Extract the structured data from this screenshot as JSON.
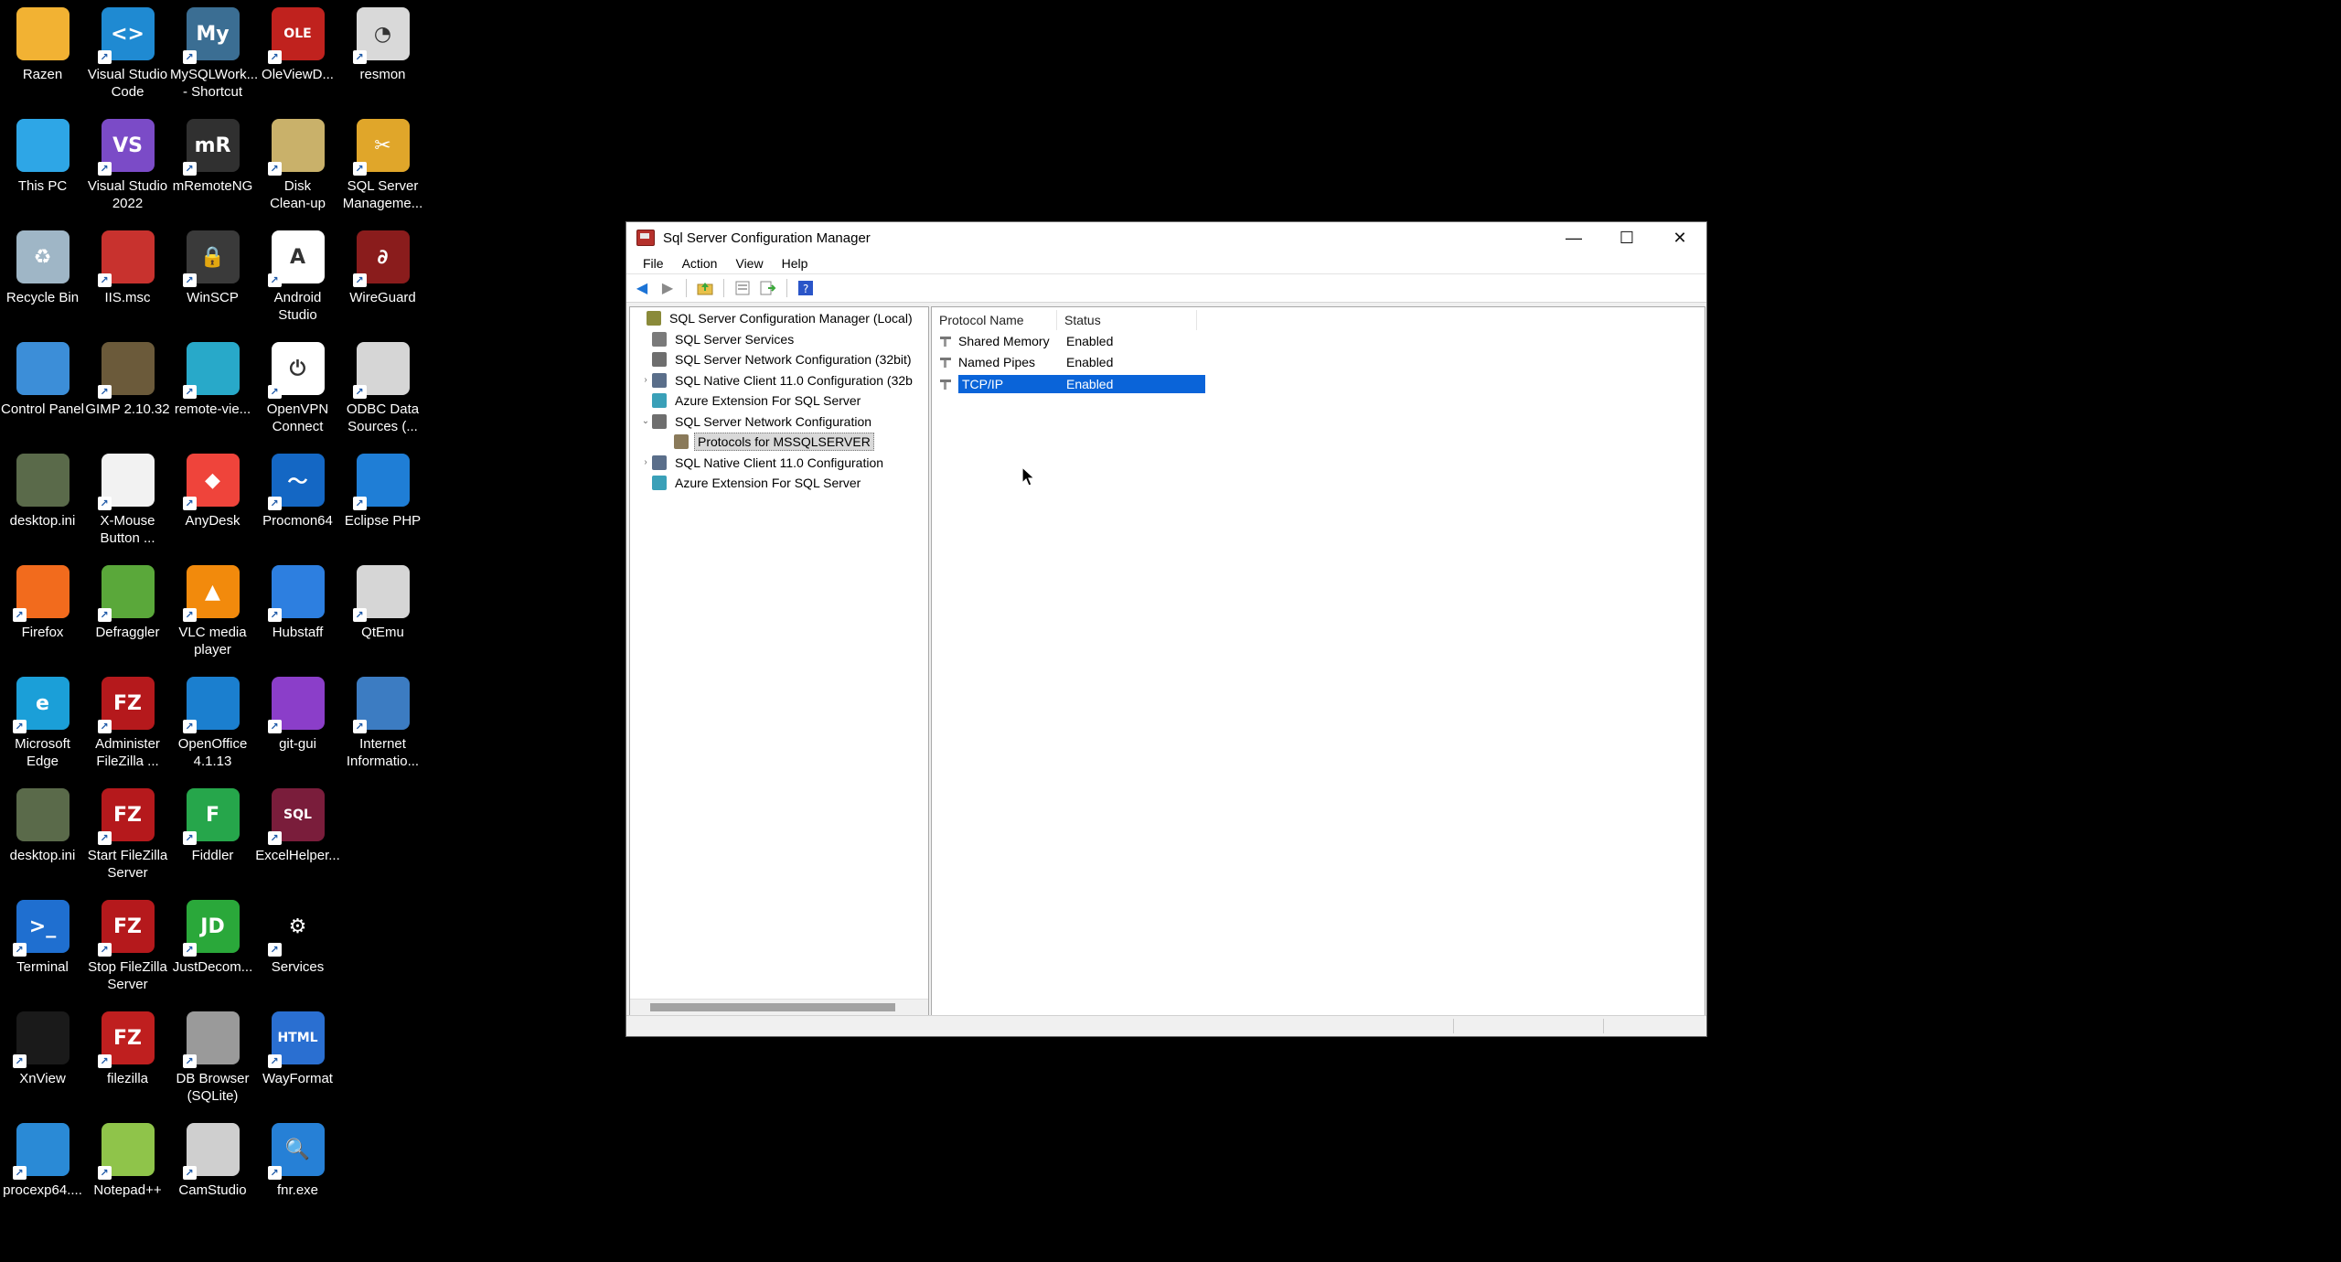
{
  "desktop": {
    "icons": [
      {
        "label": "Razen",
        "icon": "folder-icon",
        "color": "#f2b233",
        "glyph": "",
        "shortcut": false
      },
      {
        "label": "Visual Studio\nCode",
        "icon": "vscode-icon",
        "color": "#1f8ad2",
        "glyph": "<>",
        "shortcut": true
      },
      {
        "label": "MySQLWork...\n- Shortcut",
        "icon": "mysql-workbench-icon",
        "color": "#3b6e93",
        "glyph": "My",
        "shortcut": true
      },
      {
        "label": "OleViewD...",
        "icon": "oleview-icon",
        "color": "#c0221e",
        "glyph": "OLE",
        "shortcut": true
      },
      {
        "label": "resmon",
        "icon": "gauge-icon",
        "color": "#d9d9d9",
        "glyph": "◔",
        "shortcut": true
      },
      {
        "label": "This PC",
        "icon": "monitor-icon",
        "color": "#2ea6e6",
        "glyph": "",
        "shortcut": false
      },
      {
        "label": "Visual Studio\n2022",
        "icon": "visual-studio-icon",
        "color": "#7b4bc7",
        "glyph": "VS",
        "shortcut": true
      },
      {
        "label": "mRemoteNG",
        "icon": "mremoteng-icon",
        "color": "#303030",
        "glyph": "mR",
        "shortcut": true
      },
      {
        "label": "Disk\nClean-up",
        "icon": "disk-cleanup-icon",
        "color": "#c9b16a",
        "glyph": "",
        "shortcut": true
      },
      {
        "label": "SQL Server\nManageme...",
        "icon": "ssms-icon",
        "color": "#e0a62a",
        "glyph": "✂",
        "shortcut": true
      },
      {
        "label": "Recycle Bin",
        "icon": "recycle-bin-icon",
        "color": "#9fb6c6",
        "glyph": "♻",
        "shortcut": false
      },
      {
        "label": "IIS.msc",
        "icon": "toolbox-icon",
        "color": "#c8322e",
        "glyph": "",
        "shortcut": true
      },
      {
        "label": "WinSCP",
        "icon": "winscp-icon",
        "color": "#3a3a3a",
        "glyph": "🔒",
        "shortcut": true
      },
      {
        "label": "Android\nStudio",
        "icon": "android-studio-icon",
        "color": "#ffffff",
        "glyph": "A",
        "shortcut": true
      },
      {
        "label": "WireGuard",
        "icon": "wireguard-icon",
        "color": "#8a1c1c",
        "glyph": "∂",
        "shortcut": true
      },
      {
        "label": "Control Panel",
        "icon": "control-panel-icon",
        "color": "#3c8ed8",
        "glyph": "",
        "shortcut": false
      },
      {
        "label": "GIMP 2.10.32",
        "icon": "gimp-icon",
        "color": "#6b5a3a",
        "glyph": "",
        "shortcut": true
      },
      {
        "label": "remote-vie...",
        "icon": "remote-viewer-icon",
        "color": "#28a9c9",
        "glyph": "",
        "shortcut": true
      },
      {
        "label": "OpenVPN\nConnect",
        "icon": "openvpn-icon",
        "color": "#ffffff",
        "glyph": "⏻",
        "shortcut": true
      },
      {
        "label": "ODBC Data\nSources (...",
        "icon": "odbc-icon",
        "color": "#d6d6d6",
        "glyph": "",
        "shortcut": true
      },
      {
        "label": "desktop.ini",
        "icon": "ini-file-icon",
        "color": "#5a6a4a",
        "glyph": "",
        "shortcut": false
      },
      {
        "label": "X-Mouse\nButton ...",
        "icon": "mouse-icon",
        "color": "#f2f2f2",
        "glyph": "",
        "shortcut": true
      },
      {
        "label": "AnyDesk",
        "icon": "anydesk-icon",
        "color": "#ef443b",
        "glyph": "◆",
        "shortcut": true
      },
      {
        "label": "Procmon64",
        "icon": "procmon-icon",
        "color": "#1467c4",
        "glyph": "〜",
        "shortcut": true
      },
      {
        "label": "Eclipse PHP",
        "icon": "eclipse-php-icon",
        "color": "#1f7ed6",
        "glyph": "",
        "shortcut": true
      },
      {
        "label": "Firefox",
        "icon": "firefox-icon",
        "color": "#f26b1d",
        "glyph": "",
        "shortcut": true
      },
      {
        "label": "Defraggler",
        "icon": "defraggler-icon",
        "color": "#5aa83a",
        "glyph": "",
        "shortcut": true
      },
      {
        "label": "VLC media\nplayer",
        "icon": "vlc-icon",
        "color": "#f28a0c",
        "glyph": "▲",
        "shortcut": true
      },
      {
        "label": "Hubstaff",
        "icon": "hubstaff-icon",
        "color": "#2d7fe0",
        "glyph": "",
        "shortcut": true
      },
      {
        "label": "QtEmu",
        "icon": "qtemu-icon",
        "color": "#d6d6d6",
        "glyph": "",
        "shortcut": true
      },
      {
        "label": "Microsoft\nEdge",
        "icon": "edge-icon",
        "color": "#1b9fd8",
        "glyph": "e",
        "shortcut": true
      },
      {
        "label": "Administer\nFileZilla ...",
        "icon": "filezilla-server-icon",
        "color": "#b5191c",
        "glyph": "FZ",
        "shortcut": true
      },
      {
        "label": "OpenOffice\n4.1.13",
        "icon": "openoffice-icon",
        "color": "#1b7fcf",
        "glyph": "",
        "shortcut": true
      },
      {
        "label": "git-gui",
        "icon": "git-gui-icon",
        "color": "#8b3ec9",
        "glyph": "",
        "shortcut": true
      },
      {
        "label": "Internet\nInformatio...",
        "icon": "iis-manager-icon",
        "color": "#3c7cc2",
        "glyph": "",
        "shortcut": true
      },
      {
        "label": "desktop.ini",
        "icon": "ini-file-icon",
        "color": "#5a6a4a",
        "glyph": "",
        "shortcut": false
      },
      {
        "label": "Start FileZilla\nServer",
        "icon": "filezilla-server-icon",
        "color": "#b5191c",
        "glyph": "FZ",
        "shortcut": true
      },
      {
        "label": "Fiddler",
        "icon": "fiddler-icon",
        "color": "#26a64b",
        "glyph": "F",
        "shortcut": true
      },
      {
        "label": "ExcelHelper...",
        "icon": "excel-helper-icon",
        "color": "#7a1d3b",
        "glyph": "SQL",
        "shortcut": true
      },
      {
        "label": "",
        "icon": "",
        "color": "",
        "glyph": "",
        "shortcut": false
      },
      {
        "label": "Terminal",
        "icon": "terminal-icon",
        "color": "#1f6fd0",
        "glyph": ">_",
        "shortcut": true
      },
      {
        "label": "Stop FileZilla\nServer",
        "icon": "filezilla-server-icon",
        "color": "#b5191c",
        "glyph": "FZ",
        "shortcut": true
      },
      {
        "label": "JustDecom...",
        "icon": "justdecompile-icon",
        "color": "#2aa83a",
        "glyph": "JD",
        "shortcut": true
      },
      {
        "label": "Services",
        "icon": "services-gear-icon",
        "color": "#000000",
        "glyph": "⚙",
        "shortcut": true
      },
      {
        "label": "",
        "icon": "",
        "color": "",
        "glyph": "",
        "shortcut": false
      },
      {
        "label": "XnView",
        "icon": "xnview-icon",
        "color": "#1a1a1a",
        "glyph": "",
        "shortcut": true
      },
      {
        "label": "filezilla",
        "icon": "filezilla-icon",
        "color": "#bf1f1f",
        "glyph": "FZ",
        "shortcut": true
      },
      {
        "label": "DB Browser\n(SQLite)",
        "icon": "db-browser-icon",
        "color": "#9a9a9a",
        "glyph": "",
        "shortcut": true
      },
      {
        "label": "WayFormat",
        "icon": "html-icon",
        "color": "#2a6fd1",
        "glyph": "HTML",
        "shortcut": true
      },
      {
        "label": "",
        "icon": "",
        "color": "",
        "glyph": "",
        "shortcut": false
      },
      {
        "label": "procexp64....",
        "icon": "procexp-icon",
        "color": "#2a8ad6",
        "glyph": "",
        "shortcut": true
      },
      {
        "label": "Notepad++",
        "icon": "notepadpp-icon",
        "color": "#8fc44a",
        "glyph": "",
        "shortcut": true
      },
      {
        "label": "CamStudio",
        "icon": "camstudio-icon",
        "color": "#cfcfcf",
        "glyph": "",
        "shortcut": true
      },
      {
        "label": "fnr.exe",
        "icon": "fnr-search-icon",
        "color": "#2680d6",
        "glyph": "🔍",
        "shortcut": true
      },
      {
        "label": "",
        "icon": "",
        "color": "",
        "glyph": "",
        "shortcut": false
      }
    ]
  },
  "window": {
    "title": "Sql Server Configuration Manager",
    "controls": {
      "minimize": "—",
      "maximize": "☐",
      "close": "✕"
    },
    "menu": [
      "File",
      "Action",
      "View",
      "Help"
    ],
    "tree": [
      {
        "label": "SQL Server Configuration Manager (Local)",
        "expander": "",
        "icon": "server-manager-icon",
        "selected": false,
        "indent": 0
      },
      {
        "label": "SQL Server Services",
        "expander": "",
        "icon": "services-icon",
        "selected": false,
        "indent": 1
      },
      {
        "label": "SQL Server Network Configuration (32bit)",
        "expander": "",
        "icon": "network-config-icon",
        "selected": false,
        "indent": 1
      },
      {
        "label": "SQL Native Client 11.0 Configuration (32b",
        "expander": "›",
        "icon": "native-client-icon",
        "selected": false,
        "indent": 1
      },
      {
        "label": "Azure Extension For SQL Server",
        "expander": "",
        "icon": "azure-extension-icon",
        "selected": false,
        "indent": 1
      },
      {
        "label": "SQL Server Network Configuration",
        "expander": "⌄",
        "icon": "network-config-icon",
        "selected": false,
        "indent": 1
      },
      {
        "label": "Protocols for MSSQLSERVER",
        "expander": "",
        "icon": "protocols-icon",
        "selected": true,
        "indent": 2
      },
      {
        "label": "SQL Native Client 11.0 Configuration",
        "expander": "›",
        "icon": "native-client-icon",
        "selected": false,
        "indent": 1
      },
      {
        "label": "Azure Extension For SQL Server",
        "expander": "",
        "icon": "azure-extension-icon",
        "selected": false,
        "indent": 1
      }
    ],
    "list": {
      "columns": [
        "Protocol Name",
        "Status"
      ],
      "rows": [
        {
          "name": "Shared Memory",
          "status": "Enabled",
          "selected": false
        },
        {
          "name": "Named Pipes",
          "status": "Enabled",
          "selected": false
        },
        {
          "name": "TCP/IP",
          "status": "Enabled",
          "selected": true
        }
      ]
    }
  }
}
